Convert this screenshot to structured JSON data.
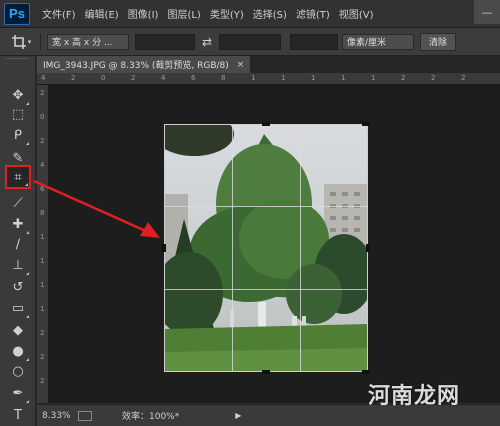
{
  "app": {
    "logo": "Ps"
  },
  "menu": {
    "items": [
      "文件(F)",
      "编辑(E)",
      "图像(I)",
      "图层(L)",
      "类型(Y)",
      "选择(S)",
      "滤镜(T)",
      "视图(V)"
    ],
    "window_minimize": "—"
  },
  "options_bar": {
    "ratio_select": "宽 x 高 x 分 ...",
    "swap_icon": "swap-arrows",
    "unit_select": "像素/厘米",
    "clear_button": "清除"
  },
  "document_tab": {
    "title": "IMG_3943.JPG @ 8.33% (裁剪预览, RGB/8)",
    "close": "×"
  },
  "rulers": {
    "top_numbers": [
      "4",
      "2",
      "0",
      "2",
      "4",
      "6",
      "8",
      "1",
      "1",
      "1",
      "1",
      "1",
      "2",
      "2",
      "2"
    ],
    "left_numbers": [
      "2",
      "0",
      "2",
      "4",
      "6",
      "8",
      "1",
      "1",
      "1",
      "1",
      "2",
      "2",
      "2"
    ]
  },
  "toolbar": {
    "tools": [
      {
        "name": "move-tool",
        "glyph": "✥"
      },
      {
        "name": "marquee-tool",
        "glyph": "⬚"
      },
      {
        "name": "lasso-tool",
        "glyph": "ᑭ"
      },
      {
        "name": "quick-selection-tool",
        "glyph": "✎"
      },
      {
        "name": "crop-tool",
        "glyph": "⌗",
        "selected": true
      },
      {
        "name": "eyedropper-tool",
        "glyph": "⟋"
      },
      {
        "name": "healing-brush-tool",
        "glyph": "✚"
      },
      {
        "name": "brush-tool",
        "glyph": "∕"
      },
      {
        "name": "clone-stamp-tool",
        "glyph": "⊥"
      },
      {
        "name": "history-brush-tool",
        "glyph": "↺"
      },
      {
        "name": "eraser-tool",
        "glyph": "▭"
      },
      {
        "name": "paint-bucket-tool",
        "glyph": "◆"
      },
      {
        "name": "blur-tool",
        "glyph": "●"
      },
      {
        "name": "dodge-tool",
        "glyph": "○"
      },
      {
        "name": "pen-tool",
        "glyph": "✒"
      },
      {
        "name": "type-tool",
        "glyph": "T"
      }
    ]
  },
  "status_bar": {
    "zoom": "8.33%",
    "efficiency": "效率：100%*",
    "menu_arrow": "▶"
  },
  "watermark": "河南龙网",
  "colors": {
    "annotation_red": "#e02020",
    "crop_grid": "#dcdcdc"
  }
}
